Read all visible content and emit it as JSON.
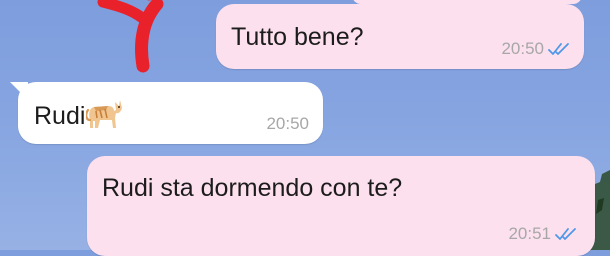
{
  "messages": [
    {
      "direction": "outgoing",
      "text": "Tutto bene?",
      "time": "20:50",
      "status_icon": "double-check-icon"
    },
    {
      "direction": "incoming",
      "text": "Rudi",
      "emoji_icon": "cat-icon",
      "time": "20:50"
    },
    {
      "direction": "outgoing",
      "text": "Rudi sta dormendo con te?",
      "time": "20:51",
      "status_icon": "double-check-icon"
    }
  ],
  "colors": {
    "outgoing_bubble": "#fde0ee",
    "incoming_bubble": "#ffffff",
    "timestamp": "#a7a7a7",
    "check_marks": "#4f98e8",
    "annotation_arrow": "#e8212b"
  }
}
